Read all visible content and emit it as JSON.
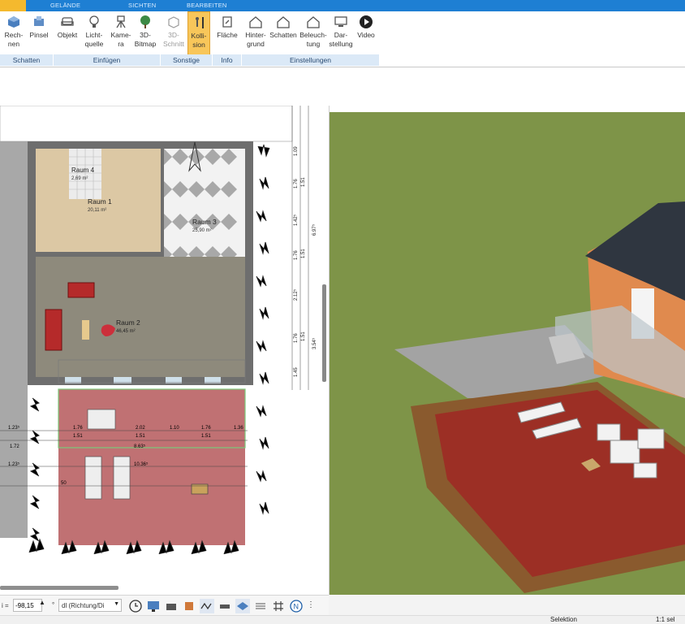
{
  "ribbon": {
    "tabs": [
      "GELÄNDE",
      "SICHTEN",
      "BEARBEITEN"
    ],
    "buttons": [
      {
        "label": "Rech-\nnen",
        "icon": "cube-icon"
      },
      {
        "label": "Pinsel",
        "icon": "brush-icon"
      },
      {
        "label": "Objekt",
        "icon": "sofa-icon"
      },
      {
        "label": "Licht-\nquelle",
        "icon": "lightbulb-icon"
      },
      {
        "label": "Kame-\nra",
        "icon": "camera-icon"
      },
      {
        "label": "3D-\nBitmap",
        "icon": "tree-icon"
      },
      {
        "label": "3D-\nSchnitt",
        "icon": "section-icon"
      },
      {
        "label": "Kolli-\nsion",
        "icon": "person-icon"
      },
      {
        "label": "Fläche",
        "icon": "area-icon"
      },
      {
        "label": "Hinter-\ngrund",
        "icon": "house-background-icon"
      },
      {
        "label": "Schatten",
        "icon": "house-shadow-icon"
      },
      {
        "label": "Beleuch-\ntung",
        "icon": "house-light-icon"
      },
      {
        "label": "Dar-\nstellung",
        "icon": "display-icon"
      },
      {
        "label": "Video",
        "icon": "play-icon"
      }
    ],
    "groups": [
      "Schatten",
      "Einfügen",
      "Sonstige",
      "Info",
      "Einstellungen"
    ]
  },
  "plan": {
    "rooms": [
      {
        "name": "Raum 4",
        "area": "2,69 m²"
      },
      {
        "name": "Raum 1",
        "area": "20,11 m²"
      },
      {
        "name": "Raum 3",
        "area": "25,90 m²"
      },
      {
        "name": "Raum 2",
        "area": "46,45 m²"
      }
    ],
    "dims_right": [
      "1.09",
      "1.76",
      "1.51",
      "1.42⁵",
      "6.97⁵",
      "1.76",
      "1.51",
      "2.12⁵",
      "1.76",
      "1.51",
      "3.54⁵",
      "1.45"
    ],
    "dims_terrace": [
      "1.23⁵",
      "1.76",
      "1.51",
      "2.02",
      "1.51",
      "1.10",
      "1.76",
      "1.51",
      "1.36",
      "1.72",
      "8.63⁵",
      "1.23⁵",
      "10.36⁵",
      "50"
    ]
  },
  "toolbar": {
    "angle_label": "i =",
    "angle_value": "-98,15",
    "unit": "°",
    "direction_value": "dl (Richtung/Di",
    "more": "⋮"
  },
  "status": {
    "mode": "Selektion",
    "selection": "1:1 sel"
  },
  "colors": {
    "ribbon_blue": "#1e7fd3",
    "accent_orange": "#f4b92e",
    "terrace_red": "#b5585a",
    "grass": "#7e9448"
  }
}
